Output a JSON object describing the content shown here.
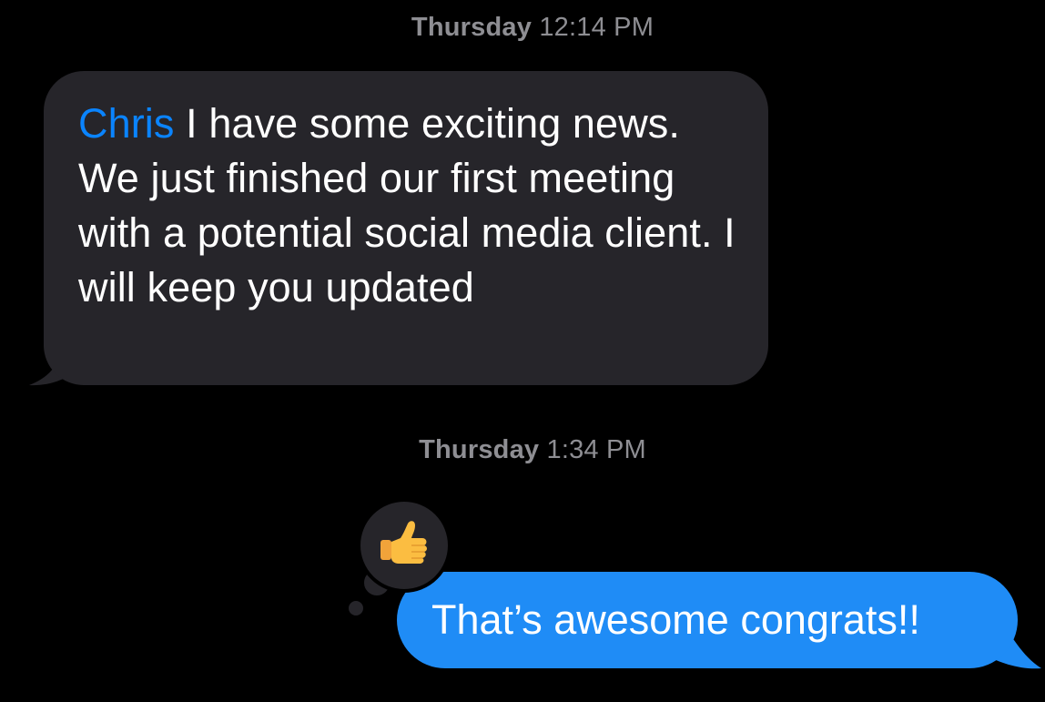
{
  "thread": {
    "messages": [
      {
        "timestamp_day": "Thursday",
        "timestamp_time": "12:14 PM",
        "direction": "incoming",
        "mention": "Chris",
        "text": "I have some exciting news.  We just finished our first meeting with a potential social media client.  I will keep you updated"
      },
      {
        "timestamp_day": "Thursday",
        "timestamp_time": "1:34 PM",
        "direction": "outgoing",
        "text": "That’s awesome congrats!!",
        "reaction": "thumbs-up-icon"
      }
    ]
  },
  "colors": {
    "background": "#000000",
    "incoming_bubble": "#26252a",
    "outgoing_bubble": "#1f8cf6",
    "mention": "#0a84ff",
    "timestamp": "#8e8e93"
  }
}
